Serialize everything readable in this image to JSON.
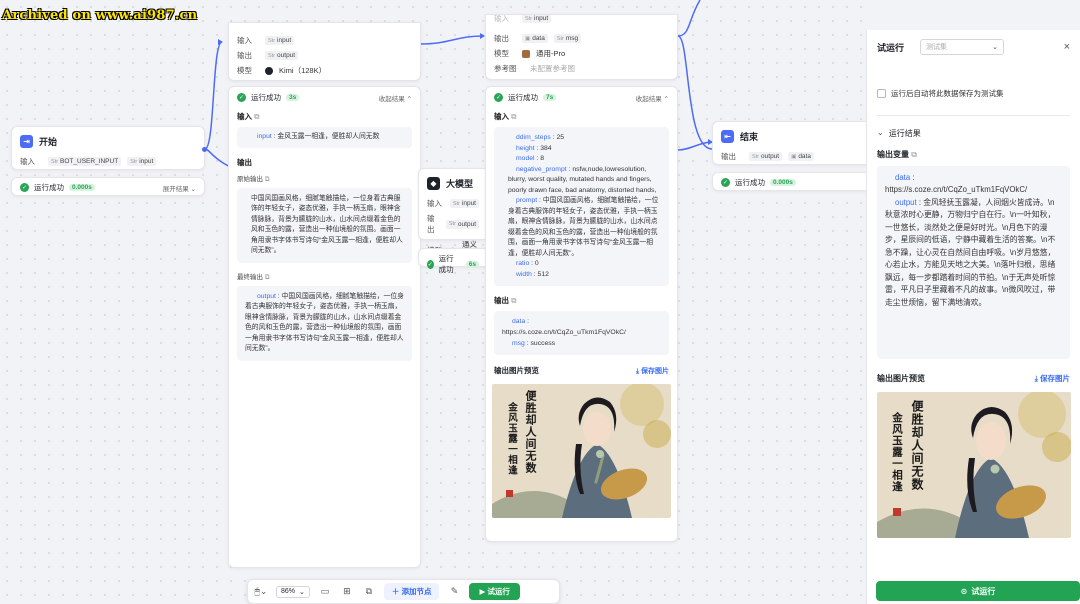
{
  "watermark": "Archived on www.ai987.cn",
  "start_node": {
    "title": "开始",
    "input_label": "输入",
    "param": "BOT_USER_INPUT",
    "param_type": "input",
    "status": "运行成功",
    "time": "0.000s",
    "expand": "展开结果"
  },
  "llm1": {
    "input_label": "输入",
    "input_val": "input",
    "output_label": "输出",
    "output_val": "output",
    "model_label": "模型",
    "model_val": "Kimi（128K）",
    "status": "运行成功",
    "time": "3s",
    "collapse": "收起结果",
    "sec_input": "输入",
    "input_text_key": "input",
    "input_text": "金风玉露一相逢，便胜却人间无数",
    "sec_output": "输出",
    "raw_label": "原始输出",
    "raw_text": "中国风国画风格，细腻笔触描绘，一位身着古典服饰的年轻女子，姿态优雅，手执一柄玉扇，眼神含情脉脉，背景为朦胧的山水，山水间点缀着金色的风和玉色的露，营造出一种仙境般的氛围。画面一角用隶书字体书写诗句“金风玉露一相逢，便胜却人间无数”。",
    "final_label": "最终输出",
    "final_key": "output",
    "final_text": "中国风国画风格，细腻笔触描绘，一位身着古典服饰的年轻女子，姿态优雅，手执一柄玉扇，眼神含情脉脉，背景为朦胧的山水，山水间点缀着金色的风和玉色的露，营造出一种仙境般的氛围，画面一角用隶书字体书写诗句“金风玉露一相逢，便胜却人间无数”。"
  },
  "llm2": {
    "title": "大模型",
    "input_label": "输入",
    "input_val": "input",
    "output_label": "输出",
    "output_val": "output",
    "model_label": "模型",
    "model_val": "通义千",
    "status": "运行成功",
    "time": "6s"
  },
  "image_node": {
    "input_val": "input",
    "output_label": "输出",
    "out1": "data",
    "out2": "msg",
    "model_label": "模型",
    "model_val": "通用-Pro",
    "ref_label": "参考图",
    "ref_val": "未配置参考图",
    "status": "运行成功",
    "time": "7s",
    "collapse": "收起结果",
    "sec_input": "输入",
    "params": [
      {
        "k": "ddim_steps",
        "v": "25"
      },
      {
        "k": "height",
        "v": "384"
      },
      {
        "k": "model",
        "v": "8"
      },
      {
        "k": "negative_prompt",
        "v": "nsfw,nude,lowresolution, blurry, worst quality, mutated hands and fingers, poorly drawn face, bad anatomy, distorted hands,"
      },
      {
        "k": "prompt",
        "v": "中国风国画风格，细腻笔触描绘，一位身着古典服饰的年轻女子，姿态优雅，手执一柄玉扇，眼神含情脉脉，背景为朦胧的山水，山水间点缀着金色的风和玉色的露，营造出一种仙境般的氛围，画面一角用隶书字体书写诗句“金风玉露一相逢，便胜却人间无数”。"
      },
      {
        "k": "ratio",
        "v": "0"
      },
      {
        "k": "width",
        "v": "512"
      }
    ],
    "sec_output": "输出",
    "out_data_key": "data",
    "out_data": "https://s.coze.cn/t/CqZo_uTkm1FqVOkC/",
    "out_msg_key": "msg",
    "out_msg": "success",
    "preview_label": "输出图片预览",
    "save_label": "保存图片",
    "poem_col1": "便胜却人间无数",
    "poem_col2": "金风玉露一相逢"
  },
  "end_node": {
    "title": "结束",
    "output_label": "输出",
    "out1": "output",
    "out2": "data",
    "status": "运行成功",
    "time": "0.000s"
  },
  "panel": {
    "title": "试运行",
    "select_placeholder": "测试集",
    "checkbox_label": "运行后自动将此数据保存为测试集",
    "result_label": "运行结果",
    "out_var_label": "输出变量",
    "data_key": "data",
    "data_val": "https://s.coze.cn/t/CqZo_uTkm1FqVOkC/",
    "output_key": "output",
    "output_val": "金风轻抚玉露凝，人间烟火皆成诗。\\n秋意浓时心更静，万物归宁自在行。\\n一叶知秋，一世悠长，淡然处之便是好时光。\\n月色下的漫步，星辰间的低语，宁静中藏着生活的答案。\\n不急不躁，让心灵在自然间自由呼吸。\\n岁月悠悠，心若止水，方能见天地之大美。\\n落叶归根，思绪飘远，每一步都踏着时间的节拍。\\n于无声处听惊雷，平凡日子里藏着不凡的故事。\\n微风吹过，带走尘世烦恼，留下满地清欢。",
    "preview_label": "输出图片预览",
    "save_label": "保存图片",
    "run_button": "试运行"
  },
  "toolbar": {
    "zoom": "86%",
    "add_node": "添加节点",
    "run": "试运行"
  }
}
